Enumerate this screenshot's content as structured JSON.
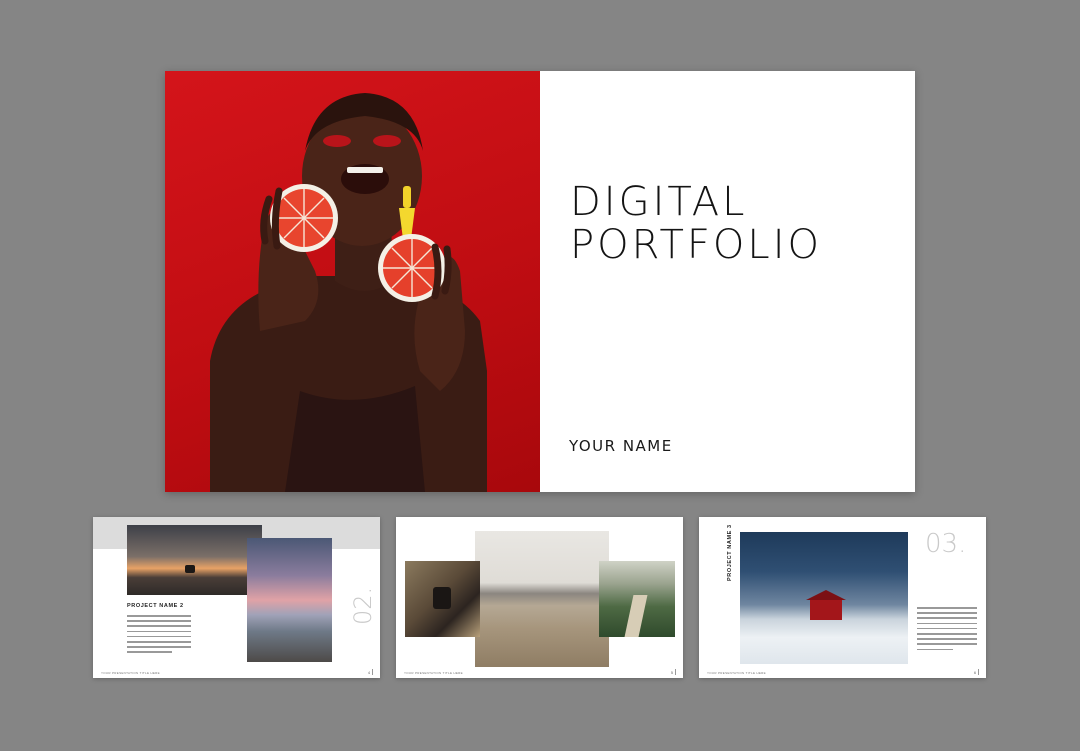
{
  "cover": {
    "title_line1": "DIGITAL",
    "title_line2": "PORTFOLIO",
    "author": "YOUR NAME",
    "accent_color": "#d4141a"
  },
  "slides": [
    {
      "project_name": "PROJECT NAME 2",
      "number": "02.",
      "footer": "YOUR PRESENTATION TITLE HERE",
      "page": "4"
    },
    {
      "footer": "YOUR PRESENTATION TITLE HERE",
      "page": "5"
    },
    {
      "project_name": "PROJECT NAME 3",
      "number": "03.",
      "footer": "YOUR PRESENTATION TITLE HERE",
      "page": "6"
    }
  ]
}
